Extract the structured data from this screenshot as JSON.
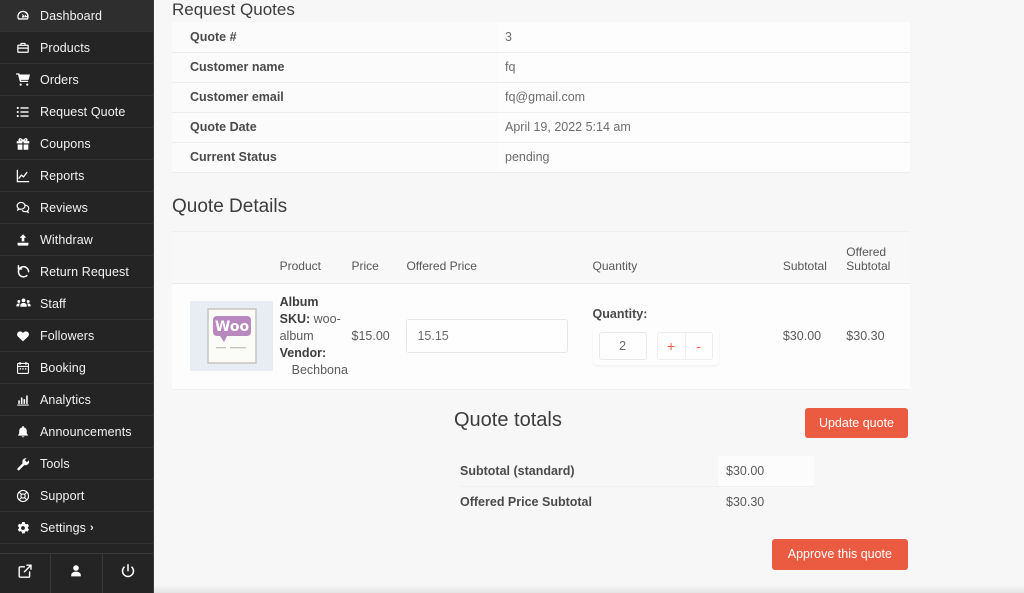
{
  "sidebar": {
    "items": [
      {
        "label": "Dashboard",
        "icon": "dashboard-icon"
      },
      {
        "label": "Products",
        "icon": "briefcase-icon"
      },
      {
        "label": "Orders",
        "icon": "cart-icon"
      },
      {
        "label": "Request Quote",
        "icon": "list-icon"
      },
      {
        "label": "Coupons",
        "icon": "gift-icon"
      },
      {
        "label": "Reports",
        "icon": "chart-line-icon"
      },
      {
        "label": "Reviews",
        "icon": "comments-icon"
      },
      {
        "label": "Withdraw",
        "icon": "upload-icon"
      },
      {
        "label": "Return Request",
        "icon": "undo-icon"
      },
      {
        "label": "Staff",
        "icon": "users-icon"
      },
      {
        "label": "Followers",
        "icon": "heart-icon"
      },
      {
        "label": "Booking",
        "icon": "calendar-icon"
      },
      {
        "label": "Analytics",
        "icon": "chart-bar-icon"
      },
      {
        "label": "Announcements",
        "icon": "bell-icon"
      },
      {
        "label": "Tools",
        "icon": "wrench-icon"
      },
      {
        "label": "Support",
        "icon": "lifebuoy-icon"
      },
      {
        "label": "Settings",
        "icon": "gear-icon",
        "chevron": "›"
      }
    ],
    "footer": [
      {
        "icon": "external-link-icon"
      },
      {
        "icon": "user-icon"
      },
      {
        "icon": "power-icon"
      }
    ]
  },
  "page": {
    "title": "Request Quotes",
    "details_title": "Quote Details"
  },
  "info": {
    "rows": [
      {
        "key": "Quote #",
        "value": "3"
      },
      {
        "key": "Customer name",
        "value": "fq"
      },
      {
        "key": "Customer email",
        "value": "fq@gmail.com"
      },
      {
        "key": "Quote Date",
        "value": "April 19, 2022 5:14 am"
      },
      {
        "key": "Current Status",
        "value": "pending"
      }
    ]
  },
  "details": {
    "columns": {
      "thumb": "",
      "product": "Product",
      "price": "Price",
      "offered_price": "Offered Price",
      "quantity": "Quantity",
      "subtotal": "Subtotal",
      "offered_subtotal_line1": "Offered",
      "offered_subtotal_line2": "Subtotal"
    },
    "row": {
      "thumb_alt": "woo-album-thumbnail",
      "name": "Album",
      "sku_label": "SKU:",
      "sku_value": "woo-album",
      "vendor_label": "Vendor:",
      "vendor_value": "Bechbona",
      "price": "$15.00",
      "offered_price_value": "15.15",
      "offered_price_placeholder": "",
      "quantity_label": "Quantity:",
      "quantity_value": "2",
      "plus_label": "+",
      "minus_label": "-",
      "subtotal": "$30.00",
      "offered_subtotal": "$30.30"
    }
  },
  "totals": {
    "title": "Quote totals",
    "update_button": "Update quote",
    "rows": [
      {
        "key": "Subtotal (standard)",
        "value": "$30.00"
      },
      {
        "key": "Offered Price Subtotal",
        "value": "$30.30"
      }
    ],
    "approve_button": "Approve this quote"
  },
  "colors": {
    "accent": "#ea5b42",
    "sidebar_bg": "#242424",
    "content_bg": "#f7f7f7"
  }
}
